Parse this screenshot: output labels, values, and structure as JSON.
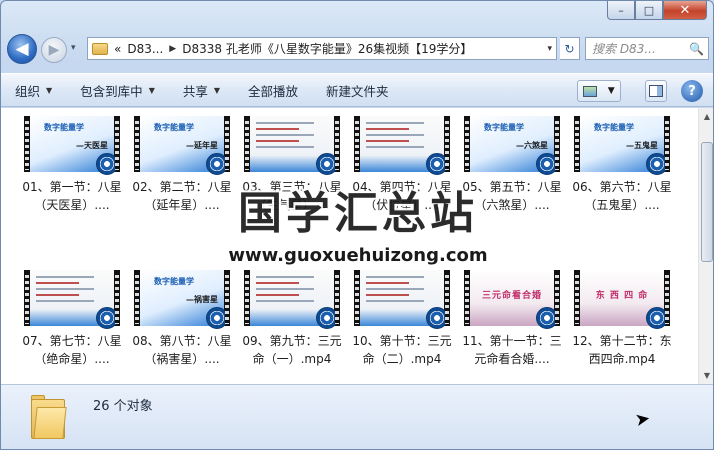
{
  "window": {
    "minimize_label": "–",
    "maximize_label": "□",
    "close_label": "✕"
  },
  "nav": {
    "back_label": "◀",
    "forward_label": "▶",
    "history_label": "▾",
    "breadcrumbs": [
      "«",
      "D83...",
      "D8338 孔老师《八星数字能量》26集视频【19学分】"
    ],
    "refresh_label": "↻",
    "search_placeholder": "搜索 D83...",
    "search_icon": "🔍"
  },
  "toolbar": {
    "organize": "组织",
    "include_library": "包含到库中",
    "share": "共享",
    "play_all": "全部播放",
    "new_folder": "新建文件夹",
    "help_label": "?"
  },
  "files": [
    {
      "name": "01、第一节：八星（天医星）....",
      "slide_title": "数字能量学",
      "slide_sub": "—天医星",
      "kind": "title"
    },
    {
      "name": "02、第二节：八星（延年星）....",
      "slide_title": "数字能量学",
      "slide_sub": "—延年星",
      "kind": "title"
    },
    {
      "name": "03、第三节：八星（生气星）....",
      "slide_title": "",
      "slide_sub": "",
      "kind": "text"
    },
    {
      "name": "04、第四节：八星（伏位星）....",
      "slide_title": "",
      "slide_sub": "",
      "kind": "text"
    },
    {
      "name": "05、第五节：八星（六煞星）....",
      "slide_title": "数字能量学",
      "slide_sub": "—六煞星",
      "kind": "title"
    },
    {
      "name": "06、第六节：八星（五鬼星）....",
      "slide_title": "数字能量学",
      "slide_sub": "—五鬼星",
      "kind": "title"
    },
    {
      "name": "07、第七节：八星（绝命星）....",
      "slide_title": "",
      "slide_sub": "",
      "kind": "text"
    },
    {
      "name": "08、第八节：八星（祸害星）....",
      "slide_title": "数字能量学",
      "slide_sub": "—祸害星",
      "kind": "title"
    },
    {
      "name": "09、第九节：三元命（一）.mp4",
      "slide_title": "",
      "slide_sub": "",
      "kind": "text"
    },
    {
      "name": "10、第十节：三元命（二）.mp4",
      "slide_title": "",
      "slide_sub": "",
      "kind": "text"
    },
    {
      "name": "11、第十一节：三元命看合婚....",
      "slide_title": "三元命看合婚",
      "slide_sub": "",
      "kind": "flower"
    },
    {
      "name": "12、第十二节：东西四命.mp4",
      "slide_title": "东 西 四 命",
      "slide_sub": "",
      "kind": "flower"
    }
  ],
  "watermark": {
    "title": "国学汇总站",
    "url": "www.guoxuehuizong.com"
  },
  "details": {
    "object_count": "26 个对象"
  },
  "scrollbar": {
    "up_label": "▲",
    "down_label": "▼"
  }
}
